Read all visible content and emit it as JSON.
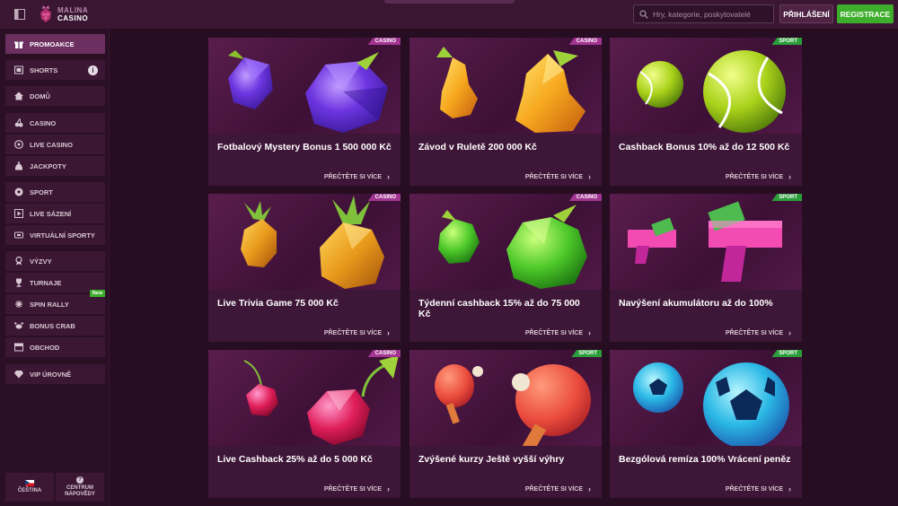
{
  "brand": {
    "line1": "MALINA",
    "line2": "CASINO",
    "accent": "#a23591",
    "green": "#3dae2b"
  },
  "header": {
    "search_placeholder": "Hry, kategorie, poskytovatelé",
    "login_label": "PŘIHLÁŠENÍ",
    "register_label": "REGISTRACE"
  },
  "sidebar": {
    "items": [
      {
        "label": "PROMOAKCE",
        "icon": "gift-icon",
        "active": true
      },
      {
        "label": "SHORTS",
        "icon": "shorts-icon"
      },
      {
        "label": "DOMŮ",
        "icon": "home-icon"
      },
      {
        "label": "CASINO",
        "icon": "cherries-icon"
      },
      {
        "label": "LIVE CASINO",
        "icon": "roulette-icon"
      },
      {
        "label": "JACKPOTY",
        "icon": "money-bag-icon"
      },
      {
        "label": "SPORT",
        "icon": "soccer-ball-icon"
      },
      {
        "label": "LIVE SÁZENÍ",
        "icon": "live-icon"
      },
      {
        "label": "VIRTUÁLNÍ SPORTY",
        "icon": "virtual-icon"
      },
      {
        "label": "VÝZVY",
        "icon": "challenge-icon"
      },
      {
        "label": "TURNAJE",
        "icon": "trophy-icon"
      },
      {
        "label": "SPIN RALLY",
        "icon": "spin-icon",
        "badge": "New"
      },
      {
        "label": "BONUS CRAB",
        "icon": "crab-icon"
      },
      {
        "label": "OBCHOD",
        "icon": "shop-icon"
      },
      {
        "label": "VIP ÚROVNĚ",
        "icon": "diamond-icon"
      }
    ],
    "language_label": "ČEŠTINA",
    "help_label_1": "CENTRUM",
    "help_label_2": "NÁPOVĚDY"
  },
  "promos": [
    {
      "title": "Fotbalový Mystery Bonus 1 500 000 Kč",
      "badge": "CASINO",
      "art": "plum",
      "more": "PŘEČTĚTE SI VÍCE"
    },
    {
      "title": "Závod v Ruletě 200 000 Kč",
      "badge": "CASINO",
      "art": "pear",
      "more": "PŘEČTĚTE SI VÍCE"
    },
    {
      "title": "Cashback Bonus 10% až do 12 500 Kč",
      "badge": "SPORT",
      "art": "tennis",
      "more": "PŘEČTĚTE SI VÍCE"
    },
    {
      "title": "Live Trivia Game 75 000 Kč",
      "badge": "CASINO",
      "art": "pineapple",
      "more": "PŘEČTĚTE SI VÍCE"
    },
    {
      "title": "Týdenní cashback 15% až do 75 000 Kč",
      "badge": "CASINO",
      "art": "apple",
      "more": "PŘEČTĚTE SI VÍCE"
    },
    {
      "title": "Navýšení akumulátoru až do 100%",
      "badge": "SPORT",
      "art": "moneygun",
      "more": "PŘEČTĚTE SI VÍCE"
    },
    {
      "title": "Live Cashback 25% až do 5 000 Kč",
      "badge": "CASINO",
      "art": "cherry",
      "more": "PŘEČTĚTE SI VÍCE"
    },
    {
      "title": "Zvýšené kurzy Ještě vyšší výhry",
      "badge": "SPORT",
      "art": "pingpong",
      "more": "PŘEČTĚTE SI VÍCE"
    },
    {
      "title": "Bezgólová remíza 100% Vrácení peněz",
      "badge": "SPORT",
      "art": "football",
      "more": "PŘEČTĚTE SI VÍCE"
    }
  ]
}
